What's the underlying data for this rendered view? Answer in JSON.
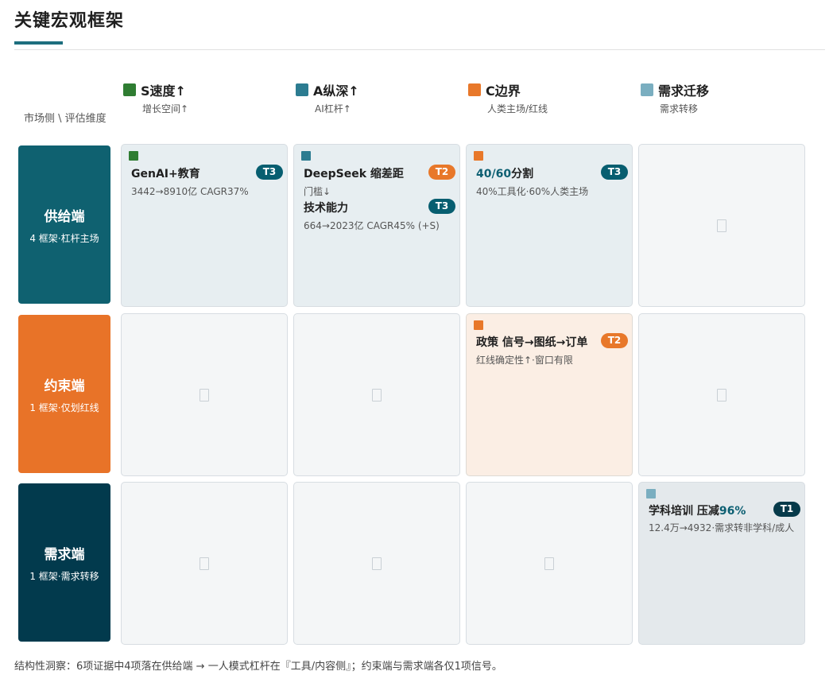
{
  "page": {
    "title": "关键宏观框架",
    "corner_label": "市场侧 \\ 评估维度",
    "footer_note": "结构性洞察：6项证据中4项落在供给端 → 一人模式杠杆在『工具/内容侧』；约束端与需求端各仅1项信号。"
  },
  "colors": {
    "teal_accent": "#1d6e7e",
    "green": "#2f7d32",
    "steel_blue": "#2c7c91",
    "orange": "#e8782a",
    "light_blue": "#7aaec0",
    "supply_row": "#0f6170",
    "constraint_row": "#e87328",
    "demand_row": "#023a4d",
    "badge_teal": "#075e70",
    "badge_navy": "#063a4a"
  },
  "columns": [
    {
      "label": "S速度↑",
      "sub": "增长空间↑",
      "swatch": "#2f7d32"
    },
    {
      "label": "A纵深↑",
      "sub": "AI杠杆↑",
      "swatch": "#2c7c91"
    },
    {
      "label": "C边界",
      "sub": "人类主场/红线",
      "swatch": "#e8782a"
    },
    {
      "label": "需求迁移",
      "sub": "需求转移",
      "swatch": "#7aaec0"
    }
  ],
  "rows": [
    {
      "title": "供给端",
      "sub": "4 框架·杠杆主场",
      "color": "#0f6170"
    },
    {
      "title": "约束端",
      "sub": "1 框架·仅划红线",
      "color": "#e87328"
    },
    {
      "title": "需求端",
      "sub": "1 框架·需求转移",
      "color": "#023a4d"
    }
  ],
  "cells": {
    "supply_s": {
      "items": [
        {
          "title": "GenAI+教育",
          "sub": "3442→8910亿 CAGR37%",
          "badge": "T3"
        }
      ]
    },
    "supply_a": {
      "items": [
        {
          "title": "DeepSeek 缩差距",
          "sub": "门槛↓",
          "badge": "T2"
        },
        {
          "title": "技术能力",
          "sub": "664→2023亿 CAGR45% (+S)",
          "badge": "T3"
        }
      ]
    },
    "supply_c": {
      "items": [
        {
          "title_highlight": "40/60",
          "title_rest": "分割",
          "sub": "40%工具化·60%人类主场",
          "badge": "T3"
        }
      ]
    },
    "constraint_c": {
      "items": [
        {
          "title": "政策 信号→图纸→订单",
          "sub": "红线确定性↑·窗口有限",
          "badge": "T2"
        }
      ]
    },
    "demand_m": {
      "items": [
        {
          "title_rest": "学科培训 压减",
          "title_highlight": "96%",
          "sub": "12.4万→4932·需求转非学科/成人",
          "badge": "T1"
        }
      ]
    }
  }
}
